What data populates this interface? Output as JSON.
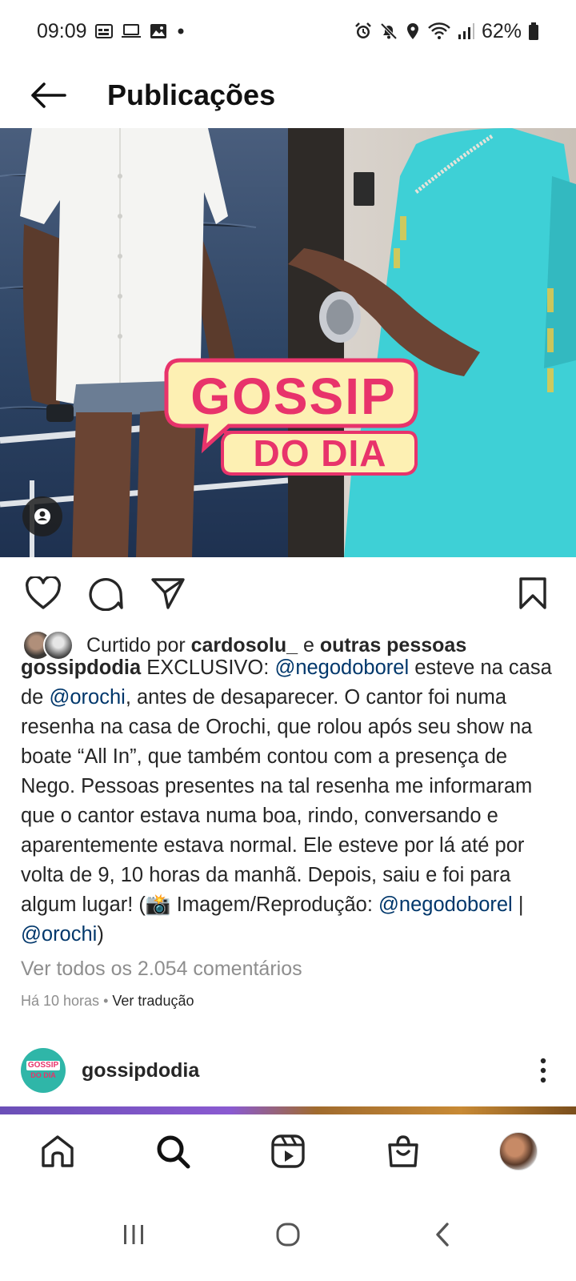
{
  "status_bar": {
    "time": "09:09",
    "battery": "62%"
  },
  "header": {
    "title": "Publicações"
  },
  "post": {
    "overlay_text_line1": "GOSSIP",
    "overlay_text_line2": "DO DIA",
    "liked_by_prefix": "Curtido por",
    "liked_by_user": "cardosolu_",
    "liked_by_conj": "e",
    "liked_by_others": "outras pessoas",
    "caption": {
      "username": "gossipdodia",
      "part1": "EXCLUSIVO:",
      "mention1": "@negodoborel",
      "part2": "esteve na casa de",
      "mention2": "@orochi",
      "part3": ", antes de desaparecer. O cantor foi numa resenha na casa de Orochi, que rolou após seu show na boate “All In”, que também contou com a presença de Nego. Pessoas presentes na tal resenha me informaram que o cantor estava numa boa, rindo, conversando e aparentemente estava normal. Ele esteve por lá até por volta de 9, 10 horas da manhã. Depois, saiu e foi para algum lugar! (📸 Imagem/Reprodução:",
      "mention3": "@negodoborel",
      "separator": "|",
      "mention4": "@orochi",
      "closing": ")"
    },
    "view_comments": "Ver todos os 2.054 comentários",
    "time_ago": "Há 10 horas",
    "dot": "•",
    "translate": "Ver tradução"
  },
  "next_post": {
    "avatar_line1": "GOSSIP",
    "avatar_line2": "DO DIA",
    "username": "gossipdodia"
  },
  "colors": {
    "mention": "#00376b",
    "muted": "#8e8e8e",
    "brand_pink": "#e8336b",
    "brand_cream": "#fdf0b3"
  }
}
